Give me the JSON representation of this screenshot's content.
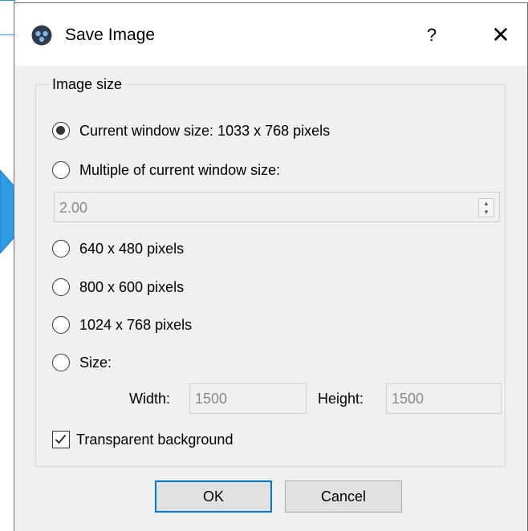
{
  "dialog": {
    "title": "Save Image",
    "help_glyph": "?",
    "close_glyph": "✕"
  },
  "image_size": {
    "group_title": "Image size",
    "options": [
      {
        "label": "Current window size: 1033 x 768 pixels",
        "checked": true
      },
      {
        "label": "Multiple of current window size:",
        "checked": false
      },
      {
        "label": "640 x 480 pixels",
        "checked": false
      },
      {
        "label": "800 x 600 pixels",
        "checked": false
      },
      {
        "label": "1024 x 768 pixels",
        "checked": false
      },
      {
        "label": "Size:",
        "checked": false
      }
    ],
    "multiple_value": "2.00",
    "width_label": "Width:",
    "width_value": "1500",
    "height_label": "Height:",
    "height_value": "1500"
  },
  "transparent_background": {
    "label": "Transparent background",
    "checked": true
  },
  "buttons": {
    "ok": "OK",
    "cancel": "Cancel"
  },
  "colors": {
    "accent": "#0078d7",
    "background_arrow": "#2f9ae6"
  },
  "icons": {
    "app": "paraview-logo-icon",
    "help": "question-mark-icon",
    "close": "close-icon",
    "spin_up": "spin-up-icon",
    "spin_down": "spin-down-icon",
    "check": "checkmark-icon"
  }
}
